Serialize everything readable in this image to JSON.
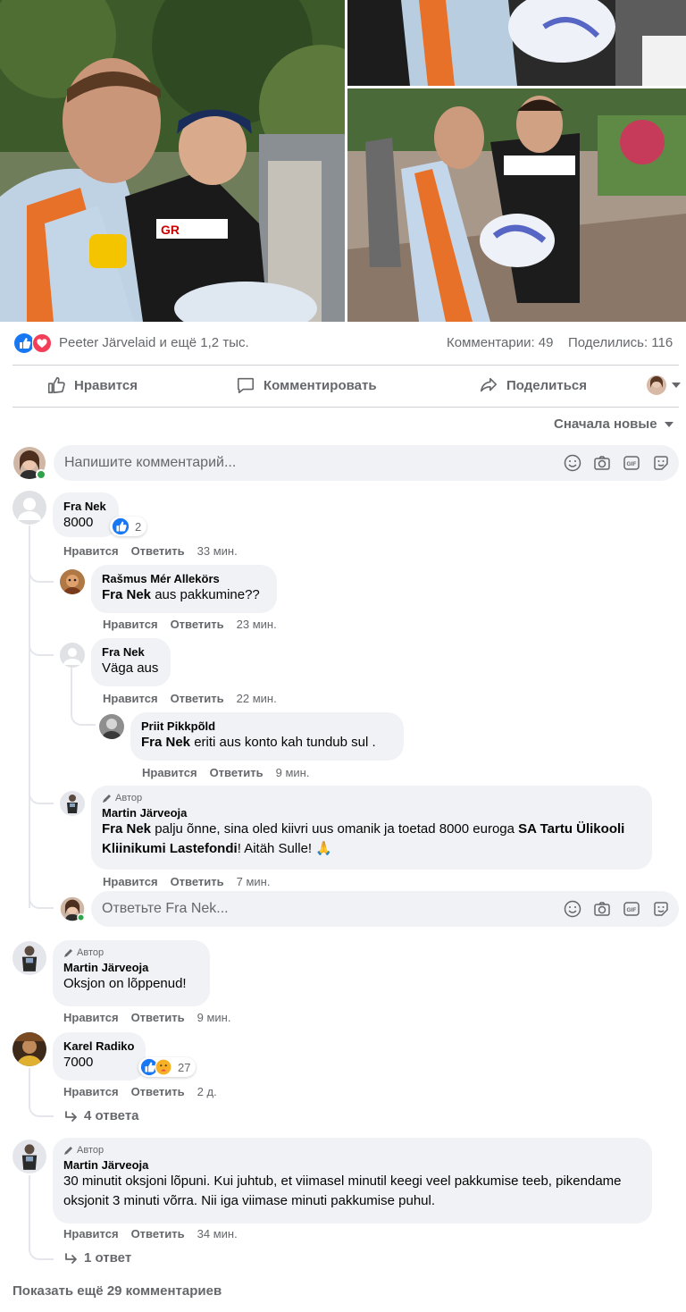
{
  "post": {
    "reactions_text": "Peeter Järvelaid и ещё 1,2 тыс.",
    "comments_count": "Комментарии: 49",
    "shares_count": "Поделились: 116",
    "like_label": "Нравится",
    "comment_label": "Комментировать",
    "share_label": "Поделиться",
    "sort_label": "Сначала новые",
    "comment_placeholder": "Напишите комментарий...",
    "reply_placeholder": "Ответьте Fra Nek...",
    "author_badge": "Автор",
    "like_action": "Нравится",
    "reply_action": "Ответить",
    "show_more": "Показать ещё 29 комментариев"
  },
  "photos": [
    {
      "icon": "photo-drivers-signing"
    },
    {
      "icon": "photo-helmet-closeup"
    },
    {
      "icon": "photo-signing-helmet"
    }
  ],
  "comments": [
    {
      "name": "Fra Nek",
      "text": "8000",
      "reactions": "2",
      "time": "33 мин."
    },
    {
      "name": "Rašmus Mér Allekörs",
      "mention": "Fra Nek",
      "text": " aus pakkumine??",
      "time": "23 мин."
    },
    {
      "name": "Fra Nek",
      "text": "Väga aus",
      "time": "22 мин."
    },
    {
      "name": "Priit Pikkpõld",
      "mention": "Fra Nek",
      "text": " eriti aus konto kah tundub sul .",
      "time": "9 мин."
    },
    {
      "name": "Martin Järveoja",
      "mention": "Fra Nek",
      "text": " palju õnne, sina oled kiivri uus omanik ja toetad 8000 euroga ",
      "bold2": "SA Tartu Ülikooli Kliinikumi Lastefondi",
      "text2": "! Aitäh Sulle! 🙏",
      "time": "7 мин."
    },
    {
      "name": "Martin Järveoja",
      "text": "Oksjon on lõppenud!",
      "time": "9 мин."
    },
    {
      "name": "Karel Radiko",
      "text": "7000",
      "reactions": "27",
      "time": "2 д.",
      "replies": "4 ответа"
    },
    {
      "name": "Martin Järveoja",
      "text": "30 minutit oksjoni lõpuni. Kui juhtub, et viimasel minutil keegi veel pakkumise teeb, pikendame oksjonit 3 minuti võrra. Nii iga viimase minuti pakkumise puhul.",
      "time": "34 мин.",
      "replies": "1 ответ"
    }
  ],
  "colors": {
    "like_blue": "#1877f2",
    "love_red": "#f33e58",
    "text_gray": "#65676b",
    "bubble": "#f0f2f5"
  }
}
